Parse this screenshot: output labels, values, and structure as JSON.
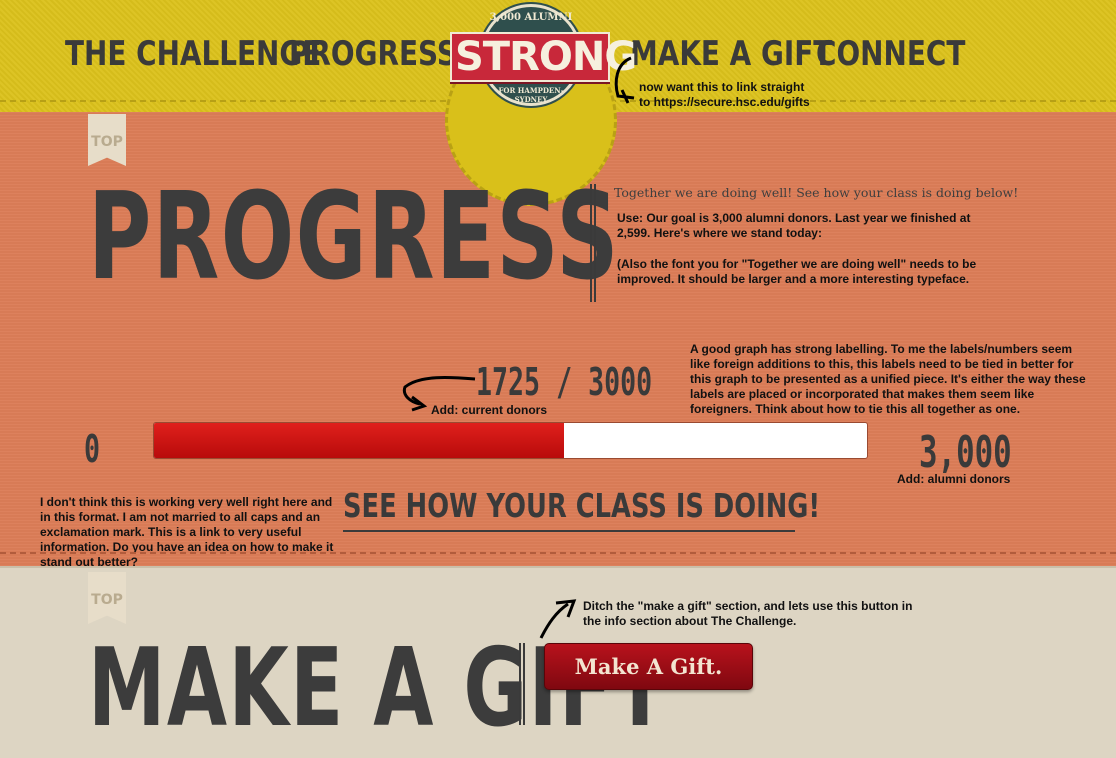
{
  "nav": {
    "challenge": "The Challenge",
    "progress": "Progress",
    "make_gift": "Make A Gift",
    "connect": "Connect"
  },
  "logo": {
    "top_text": "3,000 ALUMNI",
    "main_text": "STRONG",
    "bottom_text": "FOR HAMPDEN-SYDNEY"
  },
  "progress_section": {
    "top_tab": "TOP",
    "title": "PROGRESS",
    "intro": "Together we are doing well! See how your class is doing below!",
    "current_label": "1725 / 3000",
    "min_label": "0",
    "max_label": "3,000",
    "bar_progress": 0.575,
    "class_link": "See how your class is doing!"
  },
  "gift_section": {
    "top_tab": "TOP",
    "title": "MAKE A GIFT",
    "button_label": "Make A Gift."
  },
  "annotations": {
    "nav_note": "now want this to link straight\nto https://secure.hsc.edu/gifts",
    "use_note": "Use: Our goal is 3,000 alumni donors. Last year we finished at 2,599. Here's where we stand today:",
    "font_note": "(Also the font you for \"Together we are doing well\" needs to be improved. It should be larger and a more interesting typeface.",
    "graph_note": "A good graph has strong labelling. To me the labels/numbers seem like foreign additions to this, this labels need to be tied in better for this graph to be presented as a unified piece. It's either the way these labels are placed or incorporated that makes them seem like foreigners. Think about how to tie this all together as one.",
    "current_donors_note": "Add: current donors",
    "alumni_donors_note": "Add: alumni donors",
    "class_link_note": "I don't think this is working very well right here and in this format. I am not married to all caps and an exclamation mark. This is a link to very useful information. Do you have an idea on how to make it stand out better?",
    "gift_note": "Ditch the \"make a gift\" section, and lets use this button in the info section about The Challenge."
  },
  "colors": {
    "header_bg": "#dcc21c",
    "progress_bg": "#dc7d58",
    "gift_bg": "#ddd5c3",
    "bar_fill": "#d0140f",
    "text_dark": "#3a3a3a"
  }
}
